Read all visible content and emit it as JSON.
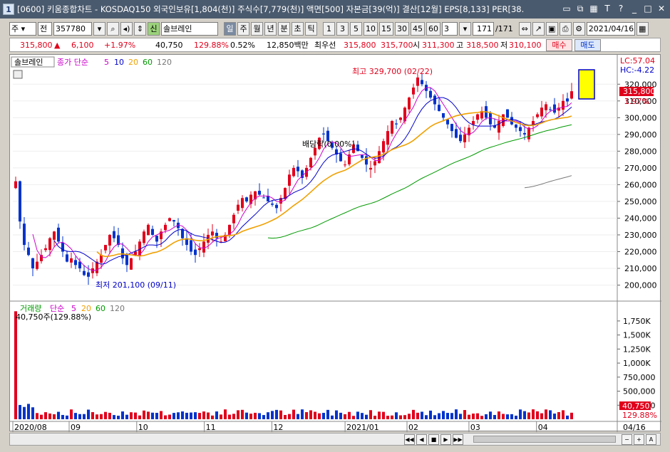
{
  "window": {
    "number": "1",
    "title": "[0600] 키움종합차트 - KOSDAQ150 외국인보유[1,804(천)] 주식수[7,779(천)] 액면[500] 자본금[39(억)] 결산[12월] EPS[8,133] PER[38."
  },
  "toolbar": {
    "type_select": "주",
    "all_select": "전",
    "code": "357780",
    "stock_badge": "신",
    "stock_name": "솔브레인",
    "periods": [
      "일",
      "주",
      "월",
      "년",
      "분",
      "초",
      "틱"
    ],
    "active_period": "일",
    "intervals": [
      "1",
      "3",
      "5",
      "10",
      "15",
      "30",
      "45",
      "60"
    ],
    "interval_value": "3",
    "count": "171",
    "count_total": "/171",
    "date": "2021/04/16"
  },
  "quote": {
    "price": "315,800",
    "change": "6,100",
    "change_pct": "+1.97%",
    "volume": "40,750",
    "volume_ratio": "129.88%",
    "turnover": "0.52%",
    "trade_value": "12,850백만",
    "best_label": "최우선",
    "best_ask": "315,800",
    "best_bid": "315,700",
    "open_label": "시",
    "open": "311,300",
    "high_label": "고",
    "high": "318,500",
    "low_label": "저",
    "low": "310,100",
    "buy_label": "매수",
    "sell_label": "매도"
  },
  "chart_data": [
    {
      "type": "candlestick",
      "title": "",
      "legend": {
        "stock": "솔브레인",
        "indicator": "종가 단순",
        "ma_periods": [
          "5",
          "10",
          "20",
          "60",
          "120"
        ],
        "ma_colors": [
          "#cc00cc",
          "#0000cc",
          "#f0a000",
          "#009900",
          "#777777"
        ]
      },
      "price_axis": {
        "ticks": [
          "320,000",
          "310,000",
          "300,000",
          "290,000",
          "280,000",
          "270,000",
          "260,000",
          "250,000",
          "240,000",
          "230,000",
          "220,000",
          "210,000",
          "200,000"
        ],
        "range": [
          193000,
          335000
        ]
      },
      "x_axis_labels": [
        "2020/08",
        "09",
        "10",
        "11",
        "12",
        "2021/01",
        "02",
        "03",
        "04"
      ],
      "x_axis_right": "04/16",
      "lc_label": "LC:57.04",
      "hc_label": "HC:-4.22",
      "current_price_label": "315,800",
      "current_pct_label": "1.97%",
      "annotations": {
        "high": "최고 329,700 (02/22)",
        "low": "최저 201,100 (09/11)",
        "dividend": "배당락(0.00%)"
      },
      "closes": [
        262000,
        238000,
        224000,
        218000,
        210000,
        214000,
        218000,
        222000,
        228000,
        232000,
        226000,
        220000,
        214000,
        216000,
        212000,
        210000,
        206000,
        205000,
        210000,
        214000,
        218000,
        224000,
        230000,
        228000,
        224000,
        216000,
        212000,
        216000,
        220000,
        226000,
        232000,
        236000,
        230000,
        226000,
        232000,
        236000,
        240000,
        238000,
        234000,
        228000,
        224000,
        220000,
        218000,
        222000,
        226000,
        230000,
        232000,
        228000,
        226000,
        230000,
        236000,
        242000,
        248000,
        252000,
        250000,
        254000,
        256000,
        254000,
        252000,
        250000,
        248000,
        246000,
        252000,
        258000,
        266000,
        270000,
        268000,
        264000,
        270000,
        276000,
        282000,
        288000,
        290000,
        286000,
        282000,
        278000,
        274000,
        272000,
        278000,
        284000,
        280000,
        276000,
        272000,
        270000,
        274000,
        280000,
        286000,
        292000,
        298000,
        296000,
        300000,
        306000,
        312000,
        318000,
        324000,
        320000,
        316000,
        312000,
        308000,
        304000,
        300000,
        296000,
        292000,
        288000,
        286000,
        290000,
        294000,
        298000,
        302000,
        304000,
        300000,
        296000,
        294000,
        298000,
        302000,
        300000,
        296000,
        294000,
        292000,
        290000,
        294000,
        298000,
        302000,
        306000,
        308000,
        305000,
        303000,
        306000,
        310000,
        309700,
        315800
      ],
      "volume_axis": {
        "ticks": [
          "1,750K",
          "1,500K",
          "1,250K",
          "1,000K",
          "750,000",
          "500,000",
          "250,000"
        ],
        "max": 1850000
      },
      "volume_legend": {
        "name": "거래량",
        "indicator": "단순",
        "periods": [
          "5",
          "20",
          "60",
          "120"
        ]
      },
      "volume_current_label": "40,750주(129.88%)",
      "volume_right_label": "40,750",
      "volume_right_pct": "129.88%"
    }
  ]
}
